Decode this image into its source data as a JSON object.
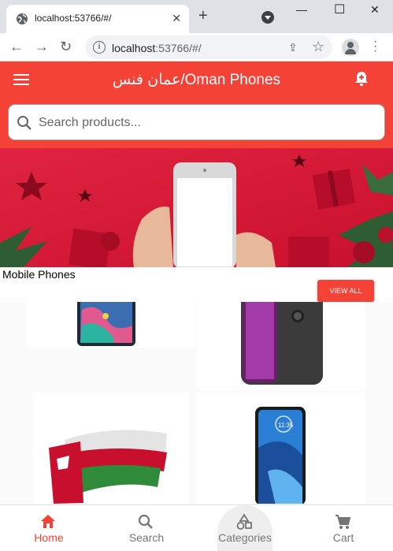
{
  "browser": {
    "tab_title": "localhost:53766/#/",
    "url_host": "localhost",
    "url_rest": ":53766/#/"
  },
  "app": {
    "title": "عمان فنس/Oman Phones",
    "search_placeholder": "Search products...",
    "section_title": "Mobile Phones",
    "view_all": "VIEW ALL"
  },
  "nav": {
    "items": [
      {
        "label": "Home",
        "icon": "home-icon",
        "active": true
      },
      {
        "label": "Search",
        "icon": "search-icon",
        "active": false
      },
      {
        "label": "Categories",
        "icon": "categories-icon",
        "active": false
      },
      {
        "label": "Cart",
        "icon": "cart-icon",
        "active": false
      }
    ]
  },
  "colors": {
    "primary": "#f44336",
    "inactive": "#757575"
  }
}
